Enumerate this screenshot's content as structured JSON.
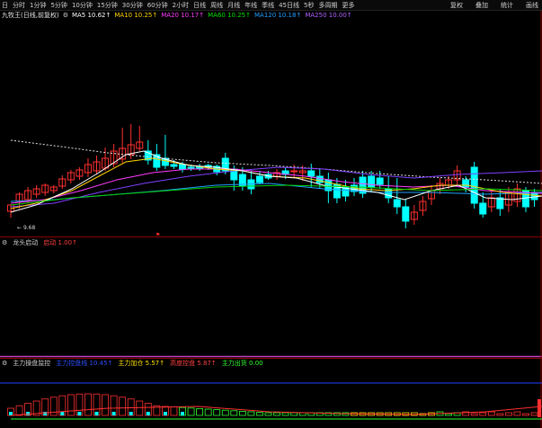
{
  "toolbar": {
    "periods": [
      "日",
      "分时",
      "1分钟",
      "5分钟",
      "10分钟",
      "15分钟",
      "30分钟",
      "60分钟",
      "2小时",
      "日线",
      "周线",
      "月线",
      "年线",
      "季线",
      "45日线",
      "5秒",
      "多周期",
      "更多"
    ],
    "right": [
      "复权",
      "叠加",
      "统计",
      "画线"
    ]
  },
  "info": {
    "stock": "九牧王(日线,前复权)",
    "ma5": "MA5 10.62↑",
    "ma10": "MA10 10.25↑",
    "ma20": "MA20 10.17↑",
    "ma60": "MA60 10.25↑",
    "ma120": "MA120 10.18↑",
    "ma250": "MA250 10.00↑"
  },
  "low_price": "9.68",
  "ind1": {
    "title": "龙头启动",
    "value": "启动 1.00↑"
  },
  "ind2": {
    "title": "主力操盘监控",
    "items": [
      {
        "label": "主力控盘",
        "value": "主力控盘线 10.45↑"
      },
      {
        "label": "主力加仓",
        "value": "主力加仓 5.57↑"
      },
      {
        "label": "高度控盘",
        "value": "高度控盘 5.87↑"
      },
      {
        "label": "主力出货",
        "value": "主力出货 0.00"
      }
    ]
  },
  "colors": {
    "up": "#ff3030",
    "down": "#00ffff",
    "bg": "#000000"
  }
}
